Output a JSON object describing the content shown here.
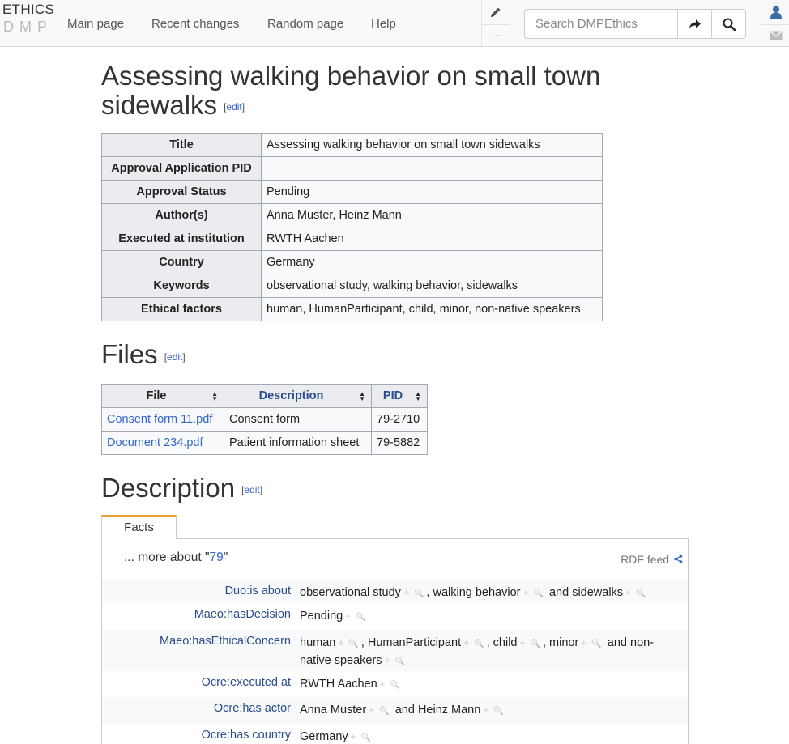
{
  "navbar": {
    "logo_top": "ETHICS",
    "logo_bottom": "DMP",
    "links": [
      "Main page",
      "Recent changes",
      "Random page",
      "Help"
    ],
    "more_label": "...",
    "search_placeholder": "Search DMPEthics"
  },
  "page": {
    "title": "Assessing walking behavior on small town sidewalks",
    "edit_label": "edit"
  },
  "infobox": [
    {
      "key": "Title",
      "value": "Assessing walking behavior on small town sidewalks"
    },
    {
      "key": "Approval Application PID",
      "value": ""
    },
    {
      "key": "Approval Status",
      "value": "Pending"
    },
    {
      "key": "Author(s)",
      "value": "Anna Muster, Heinz Mann"
    },
    {
      "key": "Executed at institution",
      "value": "RWTH Aachen"
    },
    {
      "key": "Country",
      "value": "Germany"
    },
    {
      "key": "Keywords",
      "value": "observational study, walking behavior, sidewalks"
    },
    {
      "key": "Ethical factors",
      "value": "human, HumanParticipant, child, minor, non-native speakers"
    }
  ],
  "files_section": {
    "heading": "Files",
    "columns": [
      "File",
      "Description",
      "PID"
    ],
    "rows": [
      {
        "file": "Consent form 11.pdf",
        "description": "Consent form",
        "pid": "79-2710"
      },
      {
        "file": "Document 234.pdf",
        "description": "Patient information sheet",
        "pid": "79-5882"
      }
    ]
  },
  "description_section": {
    "heading": "Description",
    "tab_label": "Facts",
    "more_about_prefix": "... more about \"",
    "more_about_link": "79",
    "more_about_suffix": "\"",
    "rdf_feed": "RDF feed",
    "facts": [
      {
        "property": "Duo:is about",
        "values": [
          "observational study",
          "walking behavior",
          "sidewalks"
        ],
        "seps": [
          ", ",
          " and "
        ]
      },
      {
        "property": "Maeo:hasDecision",
        "values": [
          "Pending"
        ],
        "seps": []
      },
      {
        "property": "Maeo:hasEthicalConcern",
        "values": [
          "human",
          "HumanParticipant",
          "child",
          "minor",
          "non-native speakers"
        ],
        "seps": [
          ", ",
          ", ",
          ", ",
          " and "
        ]
      },
      {
        "property": "Ocre:executed at",
        "values": [
          "RWTH Aachen"
        ],
        "seps": []
      },
      {
        "property": "Ocre:has actor",
        "values": [
          "Anna Muster",
          "Heinz Mann"
        ],
        "seps": [
          " and "
        ]
      },
      {
        "property": "Ocre:has country",
        "values": [
          "Germany"
        ],
        "seps": []
      }
    ]
  },
  "colors": {
    "link": "#3366cc",
    "property_link": "#2a4b8d",
    "tab_accent": "#f0a030",
    "table_header_bg": "#eaecf0",
    "table_cell_bg": "#f8f9fa"
  }
}
